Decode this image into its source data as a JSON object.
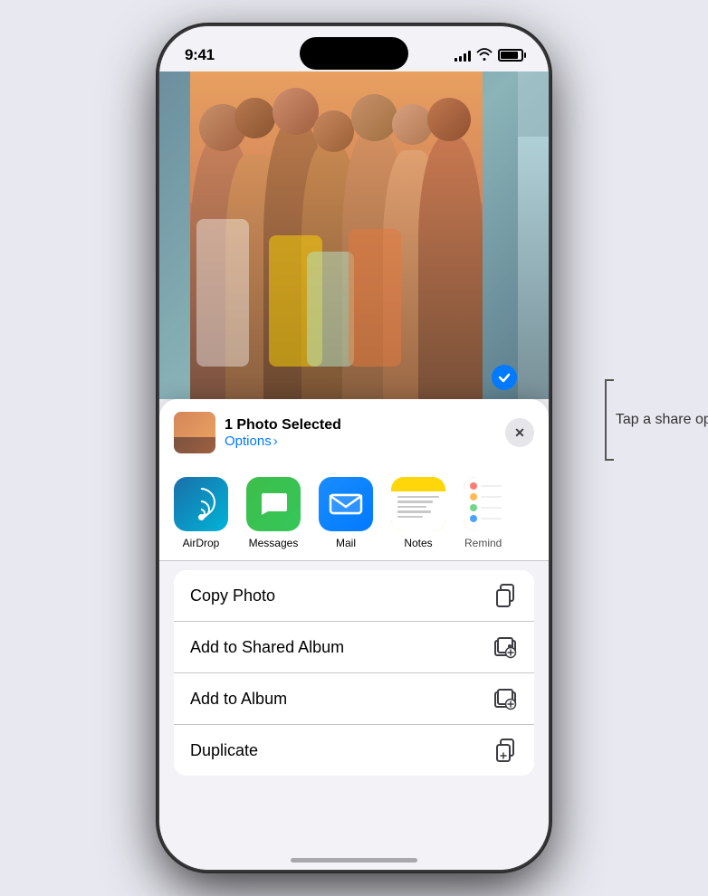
{
  "status_bar": {
    "time": "9:41",
    "signal_level": 4,
    "battery_percent": 85
  },
  "share_header": {
    "title": "1 Photo Selected",
    "options_label": "Options",
    "options_chevron": "›",
    "close_label": "✕"
  },
  "photo": {
    "selected_count": 1,
    "checkmark": "✓"
  },
  "apps": [
    {
      "id": "airdrop",
      "label": "AirDrop",
      "type": "airdrop"
    },
    {
      "id": "messages",
      "label": "Messages",
      "type": "messages",
      "icon": "💬"
    },
    {
      "id": "mail",
      "label": "Mail",
      "type": "mail",
      "icon": "✉"
    },
    {
      "id": "notes",
      "label": "Notes",
      "type": "notes"
    },
    {
      "id": "reminders",
      "label": "Reminders",
      "type": "reminders"
    }
  ],
  "actions": [
    {
      "id": "copy-photo",
      "label": "Copy Photo",
      "icon": "copy"
    },
    {
      "id": "add-to-shared-album",
      "label": "Add to Shared Album",
      "icon": "shared-album"
    },
    {
      "id": "add-to-album",
      "label": "Add to Album",
      "icon": "album"
    },
    {
      "id": "duplicate",
      "label": "Duplicate",
      "icon": "duplicate"
    }
  ],
  "annotation": {
    "text": "Tap a share option."
  },
  "colors": {
    "accent": "#007aff",
    "background": "#f2f2f7",
    "card": "#ffffff",
    "separator": "#c6c6c8",
    "label": "#000000",
    "secondary_label": "#3c3c43"
  }
}
